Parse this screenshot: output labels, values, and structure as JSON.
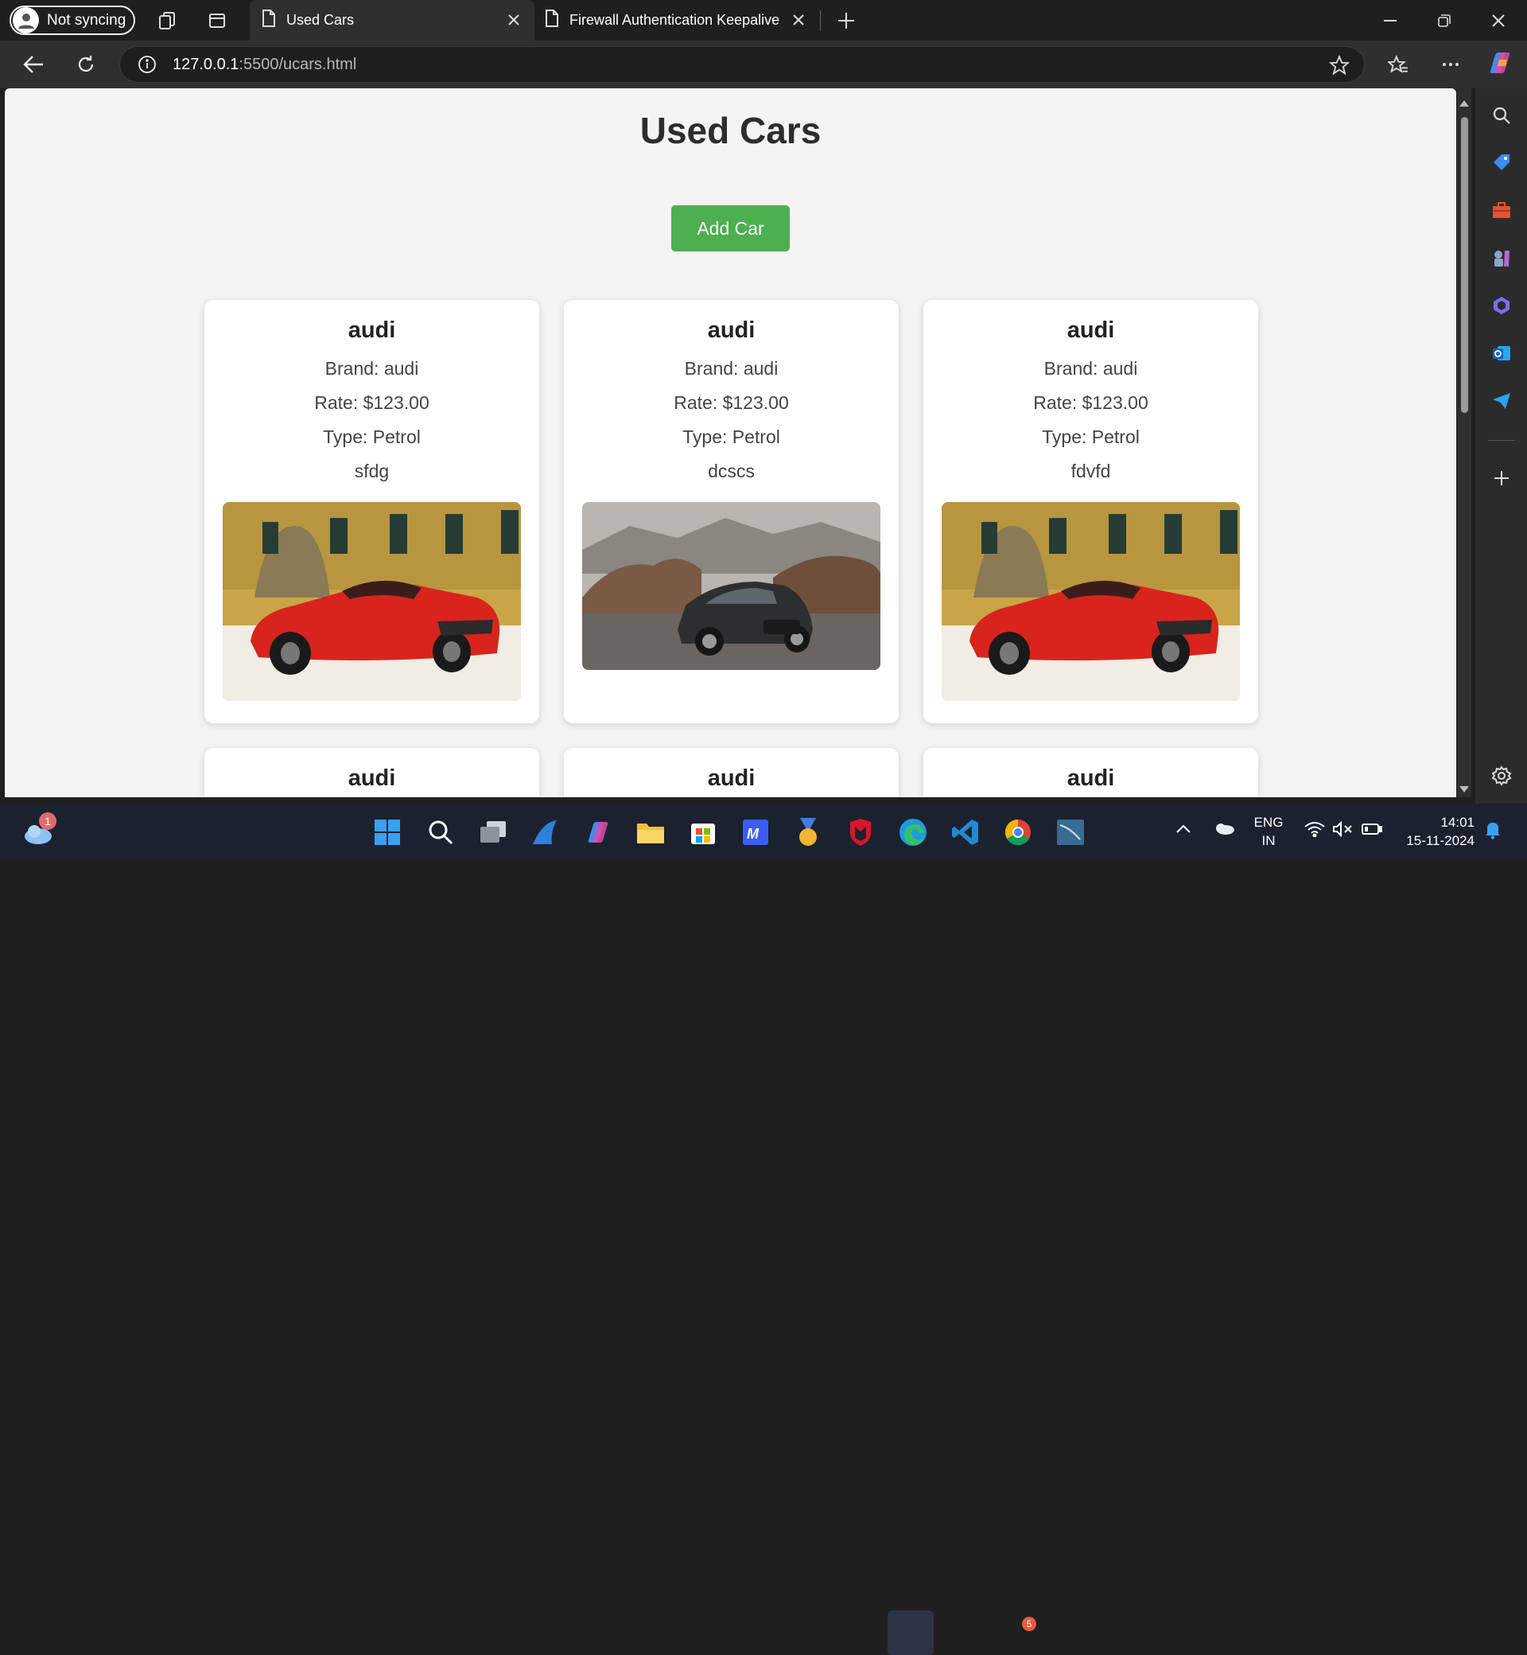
{
  "browser": {
    "profile_label": "Not syncing",
    "tabs": [
      {
        "title": "Used Cars",
        "active": true
      },
      {
        "title": "Firewall Authentication Keepalive",
        "active": false
      }
    ],
    "url_host": "127.0.0.1",
    "url_path": ":5500/ucars.html"
  },
  "page": {
    "title": "Used Cars",
    "add_button": "Add Car",
    "cars": [
      {
        "name": "audi",
        "brand": "Brand: audi",
        "rate": "Rate: $123.00",
        "type": "Type: Petrol",
        "desc": "sfdg",
        "image": "red-convertible"
      },
      {
        "name": "audi",
        "brand": "Brand: audi",
        "rate": "Rate: $123.00",
        "type": "Type: Petrol",
        "desc": "dcscs",
        "image": "dark-sedan-desert"
      },
      {
        "name": "audi",
        "brand": "Brand: audi",
        "rate": "Rate: $123.00",
        "type": "Type: Petrol",
        "desc": "fdvfd",
        "image": "red-convertible"
      },
      {
        "name": "audi"
      },
      {
        "name": "audi"
      },
      {
        "name": "audi"
      }
    ]
  },
  "taskbar": {
    "weather_badge": "1",
    "chrome_badge": "5",
    "lang_line1": "ENG",
    "lang_line2": "IN",
    "time": "14:01",
    "date": "15-11-2024"
  },
  "colors": {
    "accent_green": "#4caf50",
    "taskbar_bg": "#1c2130"
  }
}
